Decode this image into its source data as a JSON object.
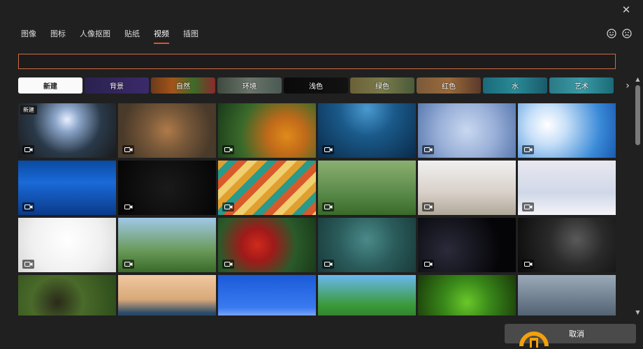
{
  "window": {
    "close_glyph": "✕"
  },
  "tabs": [
    {
      "label": "图像",
      "active": false
    },
    {
      "label": "图标",
      "active": false
    },
    {
      "label": "人像抠图",
      "active": false
    },
    {
      "label": "贴纸",
      "active": false
    },
    {
      "label": "视频",
      "active": true
    },
    {
      "label": "插图",
      "active": false
    }
  ],
  "feedback": {
    "happy_icon": "smile-icon",
    "sad_icon": "frown-icon"
  },
  "search": {
    "value": "",
    "placeholder": ""
  },
  "filters": [
    {
      "label": "新建",
      "selected": true
    },
    {
      "label": "背景"
    },
    {
      "label": "自然"
    },
    {
      "label": "环境"
    },
    {
      "label": "浅色"
    },
    {
      "label": "绿色"
    },
    {
      "label": "红色"
    },
    {
      "label": "水"
    },
    {
      "label": "艺术"
    }
  ],
  "tiles": [
    {
      "badge": "新建",
      "subject": "stadium crowd"
    },
    {
      "subject": "hen in nest"
    },
    {
      "subject": "orange flowers"
    },
    {
      "subject": "underwater bubbles"
    },
    {
      "subject": "snowflakes frame"
    },
    {
      "subject": "blue sky clouds"
    },
    {
      "subject": "blue water waves"
    },
    {
      "subject": "glowing eyes in dark"
    },
    {
      "subject": "colorful stripes"
    },
    {
      "subject": "meerkat"
    },
    {
      "subject": "sleeping kitten"
    },
    {
      "subject": "polar bear cub"
    },
    {
      "subject": "gold medal"
    },
    {
      "subject": "beach grass"
    },
    {
      "subject": "red parrot"
    },
    {
      "subject": "green water"
    },
    {
      "subject": "bubbles on black"
    },
    {
      "subject": "hand on keyboard"
    },
    {
      "subject": "gorilla"
    },
    {
      "subject": "palm tree beach"
    },
    {
      "subject": "snowy house"
    },
    {
      "subject": "palm leaves"
    },
    {
      "subject": "green snake"
    },
    {
      "subject": "window grid"
    }
  ],
  "footer": {
    "cancel_label": "取消"
  },
  "icons": {
    "video": "video-camera-icon",
    "close": "close-icon",
    "chevron": "chevron-right-icon"
  }
}
